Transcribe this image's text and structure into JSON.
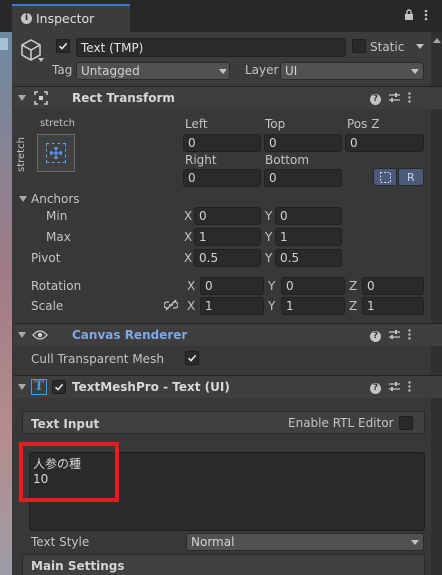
{
  "tab": {
    "title": "Inspector"
  },
  "gameobject": {
    "name": "Text (TMP)",
    "static_label": "Static",
    "tag_label": "Tag",
    "tag_value": "Untagged",
    "layer_label": "Layer",
    "layer_value": "UI"
  },
  "rect_transform": {
    "title": "Rect Transform",
    "stretch_h": "stretch",
    "stretch_v": "stretch",
    "left_label": "Left",
    "left": "0",
    "top_label": "Top",
    "top": "0",
    "posz_label": "Pos Z",
    "posz": "0",
    "right_label": "Right",
    "right": "0",
    "bottom_label": "Bottom",
    "bottom": "0",
    "r_button": "R",
    "anchors_label": "Anchors",
    "min_label": "Min",
    "min_x": "0",
    "min_y": "0",
    "max_label": "Max",
    "max_x": "1",
    "max_y": "1",
    "pivot_label": "Pivot",
    "pivot_x": "0.5",
    "pivot_y": "0.5",
    "rotation_label": "Rotation",
    "rot_x": "0",
    "rot_y": "0",
    "rot_z": "0",
    "scale_label": "Scale",
    "scale_x": "1",
    "scale_y": "1",
    "scale_z": "1",
    "axis_x": "X",
    "axis_y": "Y",
    "axis_z": "Z"
  },
  "canvas_renderer": {
    "title": "Canvas Renderer",
    "cull_label": "Cull Transparent Mesh"
  },
  "tmp": {
    "title": "TextMeshPro - Text (UI)",
    "text_input_label": "Text Input",
    "rtl_label": "Enable RTL Editor",
    "text_line1": "人参の種",
    "text_line2": "10",
    "text_style_label": "Text Style",
    "text_style_value": "Normal",
    "main_settings_label": "Main Settings"
  },
  "colors": {
    "accent_link": "#7fa8e6",
    "highlight_box": "#e02020",
    "background": "#383838"
  }
}
